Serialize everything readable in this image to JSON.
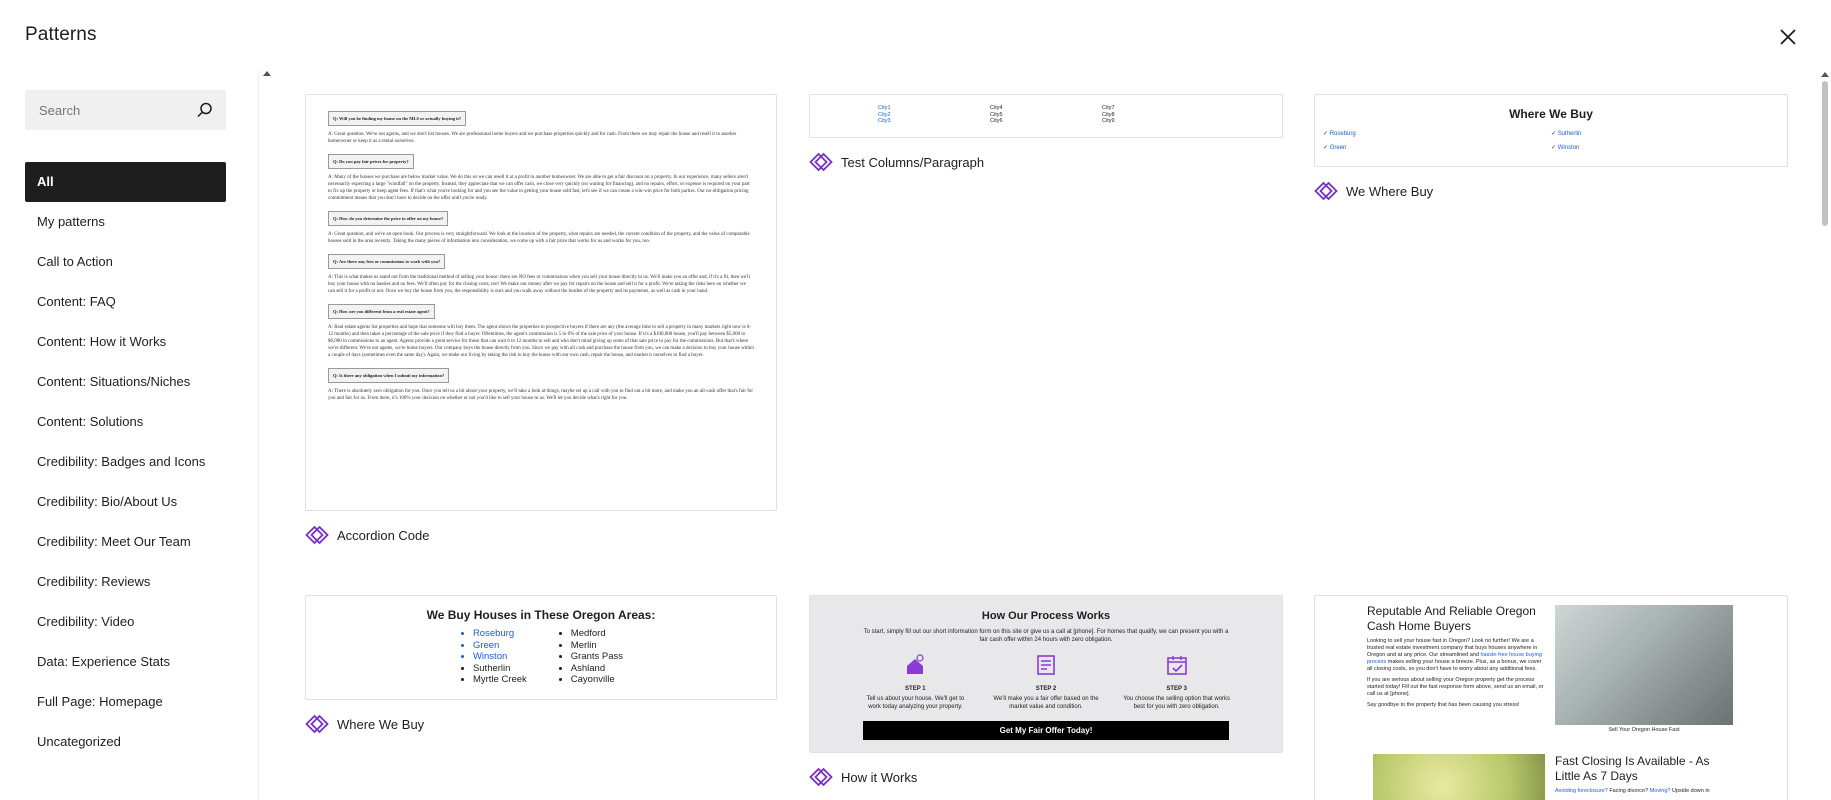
{
  "header": {
    "title": "Patterns",
    "close_icon": "close-icon"
  },
  "search": {
    "placeholder": "Search",
    "value": ""
  },
  "categories": [
    "All",
    "My patterns",
    "Call to Action",
    "Content: FAQ",
    "Content: How it Works",
    "Content: Situations/Niches",
    "Content: Solutions",
    "Credibility: Badges and Icons",
    "Credibility: Bio/About Us",
    "Credibility: Meet Our Team",
    "Credibility: Reviews",
    "Credibility: Video",
    "Data: Experience Stats",
    "Full Page: Homepage",
    "Uncategorized"
  ],
  "active_category": "All",
  "accent_color": "#7a2fc0",
  "patterns": {
    "accordion": {
      "label": "Accordion Code",
      "faq": [
        {
          "q": "Q: Will you be finding my house on the MLS or actually buying it?",
          "a": "A: Great question. We're not agents, and we don't list houses. We are professional home buyers and we purchase properties quickly and for cash. From there we may repair the house and resell it to another homeowner or keep it as a rental ourselves."
        },
        {
          "q": "Q: Do you pay fair prices for property?",
          "a": "A: Many of the houses we purchase are below market value. We do this so we can resell it at a profit to another homeowner. We are able to get a fair discount on a property. In our experience, many sellers aren't necessarily expecting a large \"windfall\" on the property. Instead, they appreciate that we can offer cash, we close very quickly (no waiting for financing), and no repairs, effort, or expense is required on your part to fix up the property or keep agent fees. If that's what you're looking for and you see the value in getting your house sold fast, let's see if we can create a win-win price for both parties. Our no-obligation pricing commitment means that you don't have to decide on the offer until you're ready."
        },
        {
          "q": "Q: How do you determine the price to offer on my house?",
          "a": "A: Great question, and we're an open book. Our process is very straightforward. We look at the location of the property, what repairs are needed, the current condition of the property, and the value of comparable houses sold in the area recently. Taking the many pieces of information into consideration, we come up with a fair price that works for us and works for you, too."
        },
        {
          "q": "Q: Are there any fees or commissions to work with you?",
          "a": "A: This is what makes us stand out from the traditional method of selling your house: there are NO fees or commissions when you sell your house directly to us. We'll make you an offer and, if it's a fit, then we'll buy your house with no hassles and no fees. We'll often pay for the closing costs, too! We make our money after we pay for repairs on the house and sell it for a profit. We're taking the risks here on whether we can sell it for a profit or not. Once we buy the house from you, the responsibility is ours and you walk away without the burden of the property and its payments, as well as cash in your hand."
        },
        {
          "q": "Q: How are you different from a real estate agent?",
          "a": "A: Real estate agents list properties and hope that someone will buy them. The agent shows the properties to prospective buyers if there are any (the average time to sell a property in many markets right now is 6-12 months) and then takes a percentage of the sale price if they find a buyer. Oftentimes, the agent's commission is 5 to 6% of the sale price of your house. If it's a $100,000 house, you'll pay between $5,000 to $6,000 in commissions to an agent. Agents provide a great service for those that can wait 6 to 12 months to sell and who don't mind giving up some of that sale price to pay for the commissions. But that's where we're different. We're not agents, we're home buyers. Our company buys the house directly from you. Since we pay with all cash and purchase the house from you, we can make a decision to buy your house within a couple of days (sometimes even the same day). Again, we make our living by taking the risk to buy the house with our own cash, repair the house, and market it ourselves to find a buyer."
        },
        {
          "q": "Q: Is there any obligation when I submit my information?",
          "a": "A: There is absolutely zero obligation for you. Once you tell us a bit about your property, we'll take a look at things, maybe set up a call with you to find out a bit more, and make you an all-cash offer that's fair for you and fair for us. From there, it's 100% your decision on whether or not you'd like to sell your house to us. We'll let you decide what's right for you."
        }
      ]
    },
    "test_columns": {
      "label": "Test Columns/Paragraph",
      "cols": [
        [
          "City1",
          "City2",
          "City3"
        ],
        [
          "City4",
          "City5",
          "City6"
        ],
        [
          "City7",
          "City8",
          "City9"
        ]
      ]
    },
    "we_where_buy": {
      "label": "We Where Buy",
      "heading": "Where We Buy",
      "items": [
        "Roseburg",
        "Sutherlin",
        "Green",
        "Winston"
      ]
    },
    "where_we_buy": {
      "label": "Where We Buy",
      "heading": "We Buy Houses in These Oregon Areas:",
      "left": [
        "Roseburg",
        "Green",
        "Winston",
        "Sutherlin",
        "Myrtle Creek"
      ],
      "right": [
        "Medford",
        "Merlin",
        "Grants Pass",
        "Ashland",
        "Cayonville"
      ]
    },
    "how_it_works": {
      "label": "How it Works",
      "heading": "How Our Process Works",
      "intro": "To start, simply fill out our short information form on this site or give us a call at [phone]. For homes that qualify, we can present you with a fair cash offer within 24 hours with zero obligation.",
      "steps": [
        {
          "title": "STEP 1",
          "text": "Tell us about your house. We'll get to work today analyzing your property."
        },
        {
          "title": "STEP 2",
          "text": "We'll make you a fair offer based on the market value and condition."
        },
        {
          "title": "STEP 3",
          "text": "You choose the selling option that works best for you with zero obligation."
        }
      ],
      "cta": "Get My Fair Offer Today!"
    },
    "homepage": {
      "heading": "Reputable And Reliable Oregon Cash Home Buyers",
      "p1_a": "Looking to sell your house fast in Oregon? Look no further! We are a trusted real estate investment company that buys houses anywhere in Oregon and at any price. Our streamlined and ",
      "p1_link": "hassle-free house buying process",
      "p1_b": " makes selling your house a breeze. Plus, as a bonus, we cover all closing costs, so you don't have to worry about any additional fees.",
      "p2": "If you are serious about selling your Oregon property get the process started today! Fill out the fast response form above, send us an email, or call us at [phone].",
      "p3": "Say goodbye to the property that has been causing you stress!",
      "caption": "Sell Your Oregon House Fast",
      "heading2": "Fast Closing Is Available - As Little As 7 Days",
      "p4_link1": "Avoiding foreclosure?",
      "p4_mid": " Facing divorce? ",
      "p4_link2": "Moving?",
      "p4_end": " Upside down in"
    }
  }
}
